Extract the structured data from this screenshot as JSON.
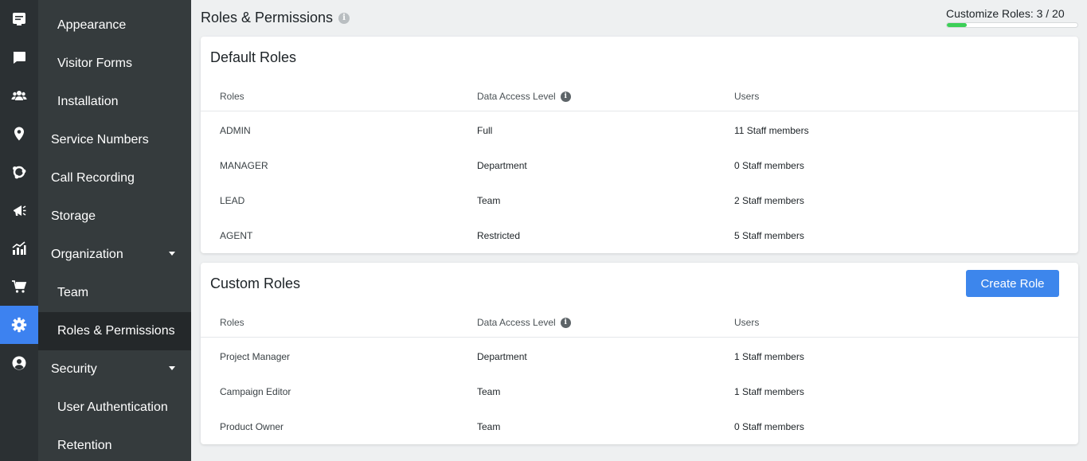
{
  "rail": {
    "icons": [
      "monitor-chat-icon",
      "chat-bubble-icon",
      "users-icon",
      "location-pin-icon",
      "integrations-icon",
      "campaigns-icon",
      "analytics-icon",
      "cart-icon",
      "gear-icon",
      "account-icon"
    ]
  },
  "sidebar": {
    "items": [
      {
        "label": "Appearance"
      },
      {
        "label": "Visitor Forms"
      },
      {
        "label": "Installation"
      },
      {
        "label": "Service Numbers"
      },
      {
        "label": "Call Recording"
      },
      {
        "label": "Storage"
      },
      {
        "label": "Organization"
      },
      {
        "label": "Team"
      },
      {
        "label": "Roles & Permissions"
      },
      {
        "label": "Security"
      },
      {
        "label": "User Authentication"
      },
      {
        "label": "Retention"
      }
    ]
  },
  "header": {
    "title": "Roles & Permissions",
    "info_icon": "i",
    "quota_label": "Customize Roles: 3 / 20",
    "quota_used": 3,
    "quota_total": 20
  },
  "default_roles": {
    "title": "Default Roles",
    "columns": [
      "Roles",
      "Data Access Level",
      "Users"
    ],
    "rows": [
      {
        "role": "ADMIN",
        "access": "Full",
        "users": "11 Staff members"
      },
      {
        "role": "MANAGER",
        "access": "Department",
        "users": "0 Staff members"
      },
      {
        "role": "LEAD",
        "access": "Team",
        "users": "2 Staff members"
      },
      {
        "role": "AGENT",
        "access": "Restricted",
        "users": "5 Staff members"
      }
    ]
  },
  "custom_roles": {
    "title": "Custom Roles",
    "create_label": "Create Role",
    "columns": [
      "Roles",
      "Data Access Level",
      "Users"
    ],
    "rows": [
      {
        "role": "Project Manager",
        "access": "Department",
        "users": "1 Staff members"
      },
      {
        "role": "Campaign Editor",
        "access": "Team",
        "users": "1 Staff members"
      },
      {
        "role": "Product Owner",
        "access": "Team",
        "users": "0 Staff members"
      }
    ]
  },
  "colors": {
    "accent": "#3d82f0",
    "progress": "#3ccf57",
    "sidebar_bg": "#353b3d",
    "rail_bg": "#2b3033"
  }
}
